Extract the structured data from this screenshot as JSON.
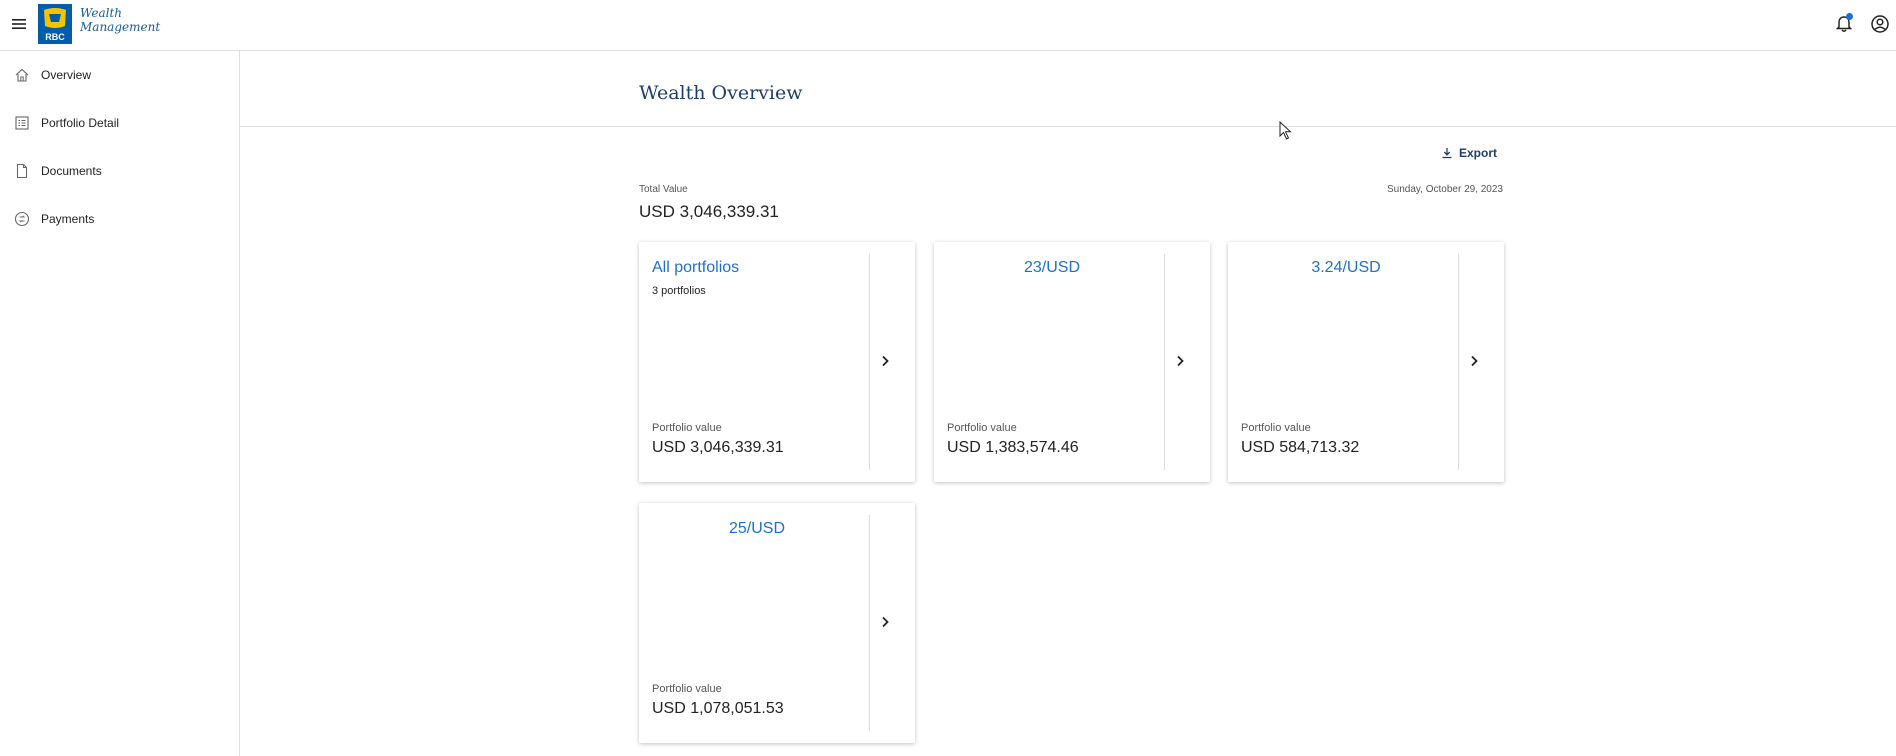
{
  "header": {
    "logo_line1": "Wealth",
    "logo_line2": "Management",
    "logo_mark": "RBC",
    "icons": [
      "menu-icon",
      "bell-icon",
      "account-icon"
    ]
  },
  "sidebar": {
    "items": [
      {
        "label": "Overview",
        "icon": "home-icon"
      },
      {
        "label": "Portfolio Detail",
        "icon": "list-icon"
      },
      {
        "label": "Documents",
        "icon": "document-icon"
      },
      {
        "label": "Payments",
        "icon": "payments-icon"
      }
    ]
  },
  "main": {
    "title": "Wealth Overview",
    "export_label": "Export",
    "total_label": "Total Value",
    "total_value": "USD 3,046,339.31",
    "date": "Sunday, October 29, 2023",
    "cards": [
      {
        "name": "All portfolios",
        "sub": "3 portfolios",
        "pv_label": "Portfolio value",
        "pv_value": "USD 3,046,339.31"
      },
      {
        "name": "23/USD",
        "sub": "",
        "pv_label": "Portfolio value",
        "pv_value": "USD 1,383,574.46"
      },
      {
        "name": "3.24/USD",
        "sub": "",
        "pv_label": "Portfolio value",
        "pv_value": "USD 584,713.32"
      },
      {
        "name": "25/USD",
        "sub": "",
        "pv_label": "Portfolio value",
        "pv_value": "USD 1,078,051.53"
      }
    ]
  },
  "colors": {
    "brand_blue": "#1f3e6b",
    "link_blue": "#1f6fd1",
    "logo_blue": "#1a5a96",
    "logo_yellow": "#f2c500"
  }
}
